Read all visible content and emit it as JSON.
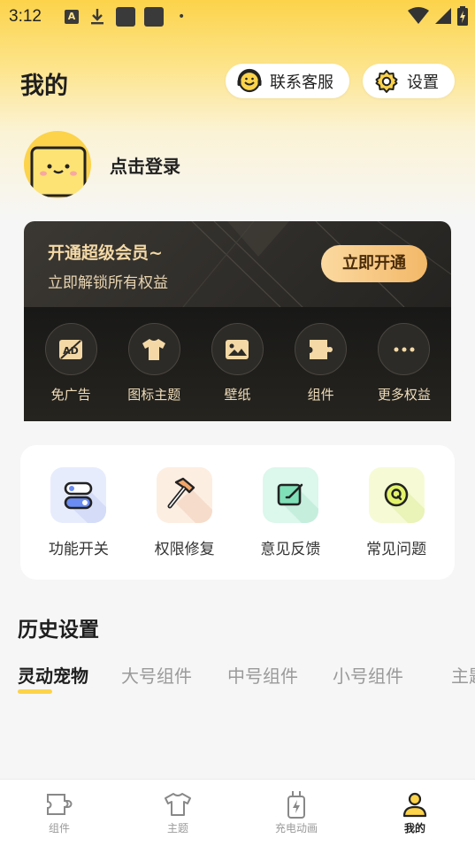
{
  "status_bar": {
    "time": "3:12",
    "dot": "•",
    "icons": [
      "app-a-icon",
      "download-icon",
      "app-square-icon",
      "app-square-icon",
      "wifi-icon",
      "signal-icon",
      "battery-charging-icon"
    ]
  },
  "header": {
    "title": "我的",
    "service_label": "联系客服",
    "settings_label": "设置"
  },
  "profile": {
    "login_label": "点击登录"
  },
  "vip": {
    "title": "开通超级会员~",
    "subtitle": "立即解锁所有权益",
    "button_label": "立即开通",
    "perks": [
      {
        "label": "免广告",
        "icon": "no-ads-icon"
      },
      {
        "label": "图标主题",
        "icon": "tshirt-icon"
      },
      {
        "label": "壁纸",
        "icon": "image-icon"
      },
      {
        "label": "组件",
        "icon": "widget-icon"
      },
      {
        "label": "更多权益",
        "icon": "more-icon"
      }
    ]
  },
  "tools": [
    {
      "label": "功能开关",
      "icon": "toggle-icon",
      "bg": "#e7ecfd"
    },
    {
      "label": "权限修复",
      "icon": "hammer-icon",
      "bg": "#fdeee2"
    },
    {
      "label": "意见反馈",
      "icon": "feedback-icon",
      "bg": "#dcf7ec"
    },
    {
      "label": "常见问题",
      "icon": "faq-icon",
      "bg": "#f6fbd6"
    }
  ],
  "history": {
    "title": "历史设置",
    "tabs": [
      "灵动宠物",
      "大号组件",
      "中号组件",
      "小号组件",
      "主题"
    ],
    "active_tab": "灵动宠物"
  },
  "bottom_nav": {
    "items": [
      {
        "label": "组件",
        "icon": "widget-icon"
      },
      {
        "label": "主题",
        "icon": "tshirt-icon"
      },
      {
        "label": "充电动画",
        "icon": "charging-icon"
      },
      {
        "label": "我的",
        "icon": "person-icon"
      }
    ],
    "active": "我的"
  },
  "colors": {
    "accent_yellow": "#fcd34a",
    "vip_gold": "#f4d9a6",
    "vip_dark": "#2b2926"
  }
}
